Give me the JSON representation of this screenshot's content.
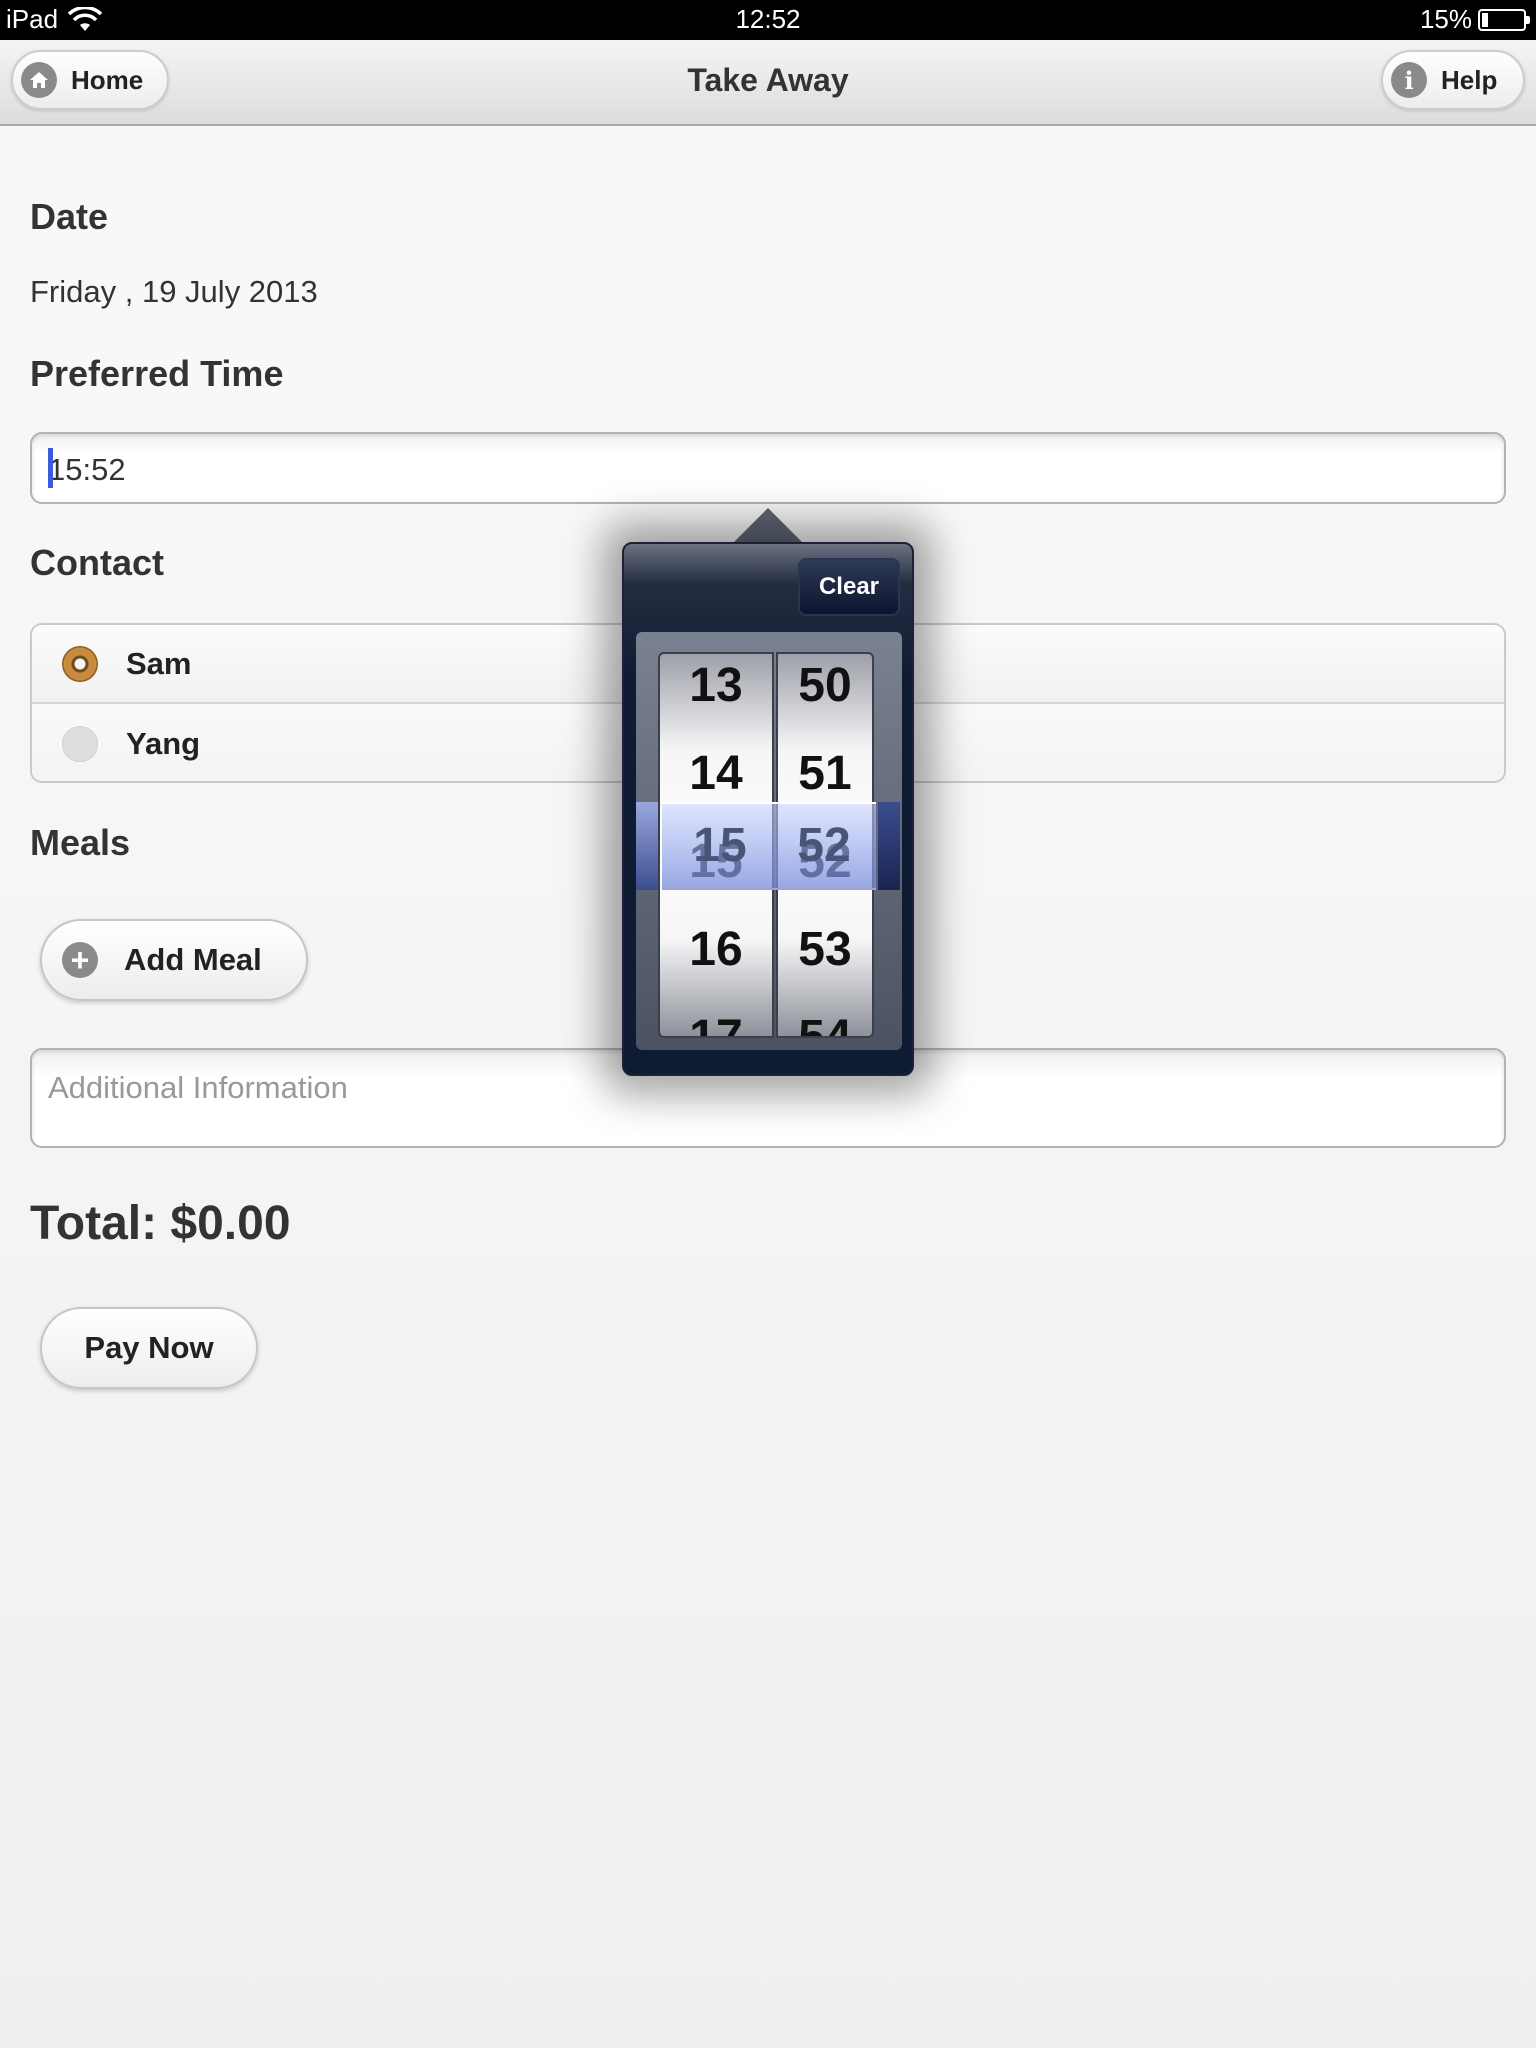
{
  "status_bar": {
    "device": "iPad",
    "time": "12:52",
    "battery": "15%"
  },
  "header": {
    "title": "Take Away",
    "home_label": "Home",
    "help_label": "Help"
  },
  "form": {
    "date_label": "Date",
    "date_value": "Friday , 19 July 2013",
    "time_label": "Preferred Time",
    "time_value": "15:52",
    "contact_label": "Contact",
    "contacts": [
      {
        "name": "Sam",
        "selected": true
      },
      {
        "name": "Yang",
        "selected": false
      }
    ],
    "meals_label": "Meals",
    "add_meal_label": "Add Meal",
    "additional_info_placeholder": "Additional Information",
    "total": "Total: $0.00",
    "pay_now_label": "Pay Now"
  },
  "picker": {
    "clear_label": "Clear",
    "hours": [
      "13",
      "14",
      "15",
      "16",
      "17"
    ],
    "minutes": [
      "50",
      "51",
      "52",
      "53",
      "54"
    ],
    "selected_hour": "15",
    "selected_minute": "52"
  },
  "colors": {
    "caret": "#3b5bdb",
    "radio_selected": "#c88a3e",
    "picker_bg": "#0f1a33"
  }
}
